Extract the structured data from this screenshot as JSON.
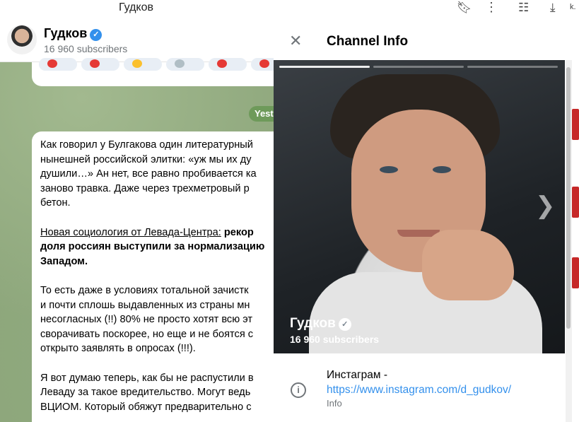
{
  "browser": {
    "tab_title": "Гудков",
    "partial_text": "k.",
    "icons": [
      "bookmark-icon",
      "more-vert-icon",
      "extensions-icon",
      "download-icon"
    ]
  },
  "chat": {
    "header": {
      "name": "Гудков",
      "subscribers": "16 960 subscribers"
    },
    "date_pill": "Yest",
    "post": {
      "p1": [
        "Как говорил у Булгакова один литературный",
        "нынешней российской элитки: «уж мы их ду",
        "душили…» Ан нет, все равно пробивается ка",
        "заново травка. Даже через трехметровый р",
        "бетон."
      ],
      "p2_link": "Новая социология от Левада-Центра:",
      "p2_bold_first": " рекор",
      "p2_bold": [
        "доля россиян выступили за нормализацию",
        "Западом."
      ],
      "p3": [
        "То есть даже в условиях тотальной зачистк",
        "и почти сплошь выдавленных из страны мн",
        "несогласных (!!) 80% не просто хотят всю эт",
        "сворачивать поскорее, но еще и не боятся с",
        "открыто заявлять в опросах (!!!)."
      ],
      "p4": [
        "Я вот думаю теперь, как бы не распустили в",
        "Леваду за такое вредительство. Могут ведь",
        "ВЦИОМ. Который обяжут предварительно с"
      ]
    }
  },
  "panel": {
    "title": "Channel Info",
    "photo_name": "Гудков",
    "photo_subscribers": "16 960 subscribers",
    "info_prefix": "Инстаграм - ",
    "info_link": "https://www.instagram.com/d_gudkov/",
    "info_label": "Info"
  },
  "colors": {
    "accent": "#3390ec",
    "chat_bg": "#8ea77c",
    "date_pill": "#6e9a5a"
  }
}
